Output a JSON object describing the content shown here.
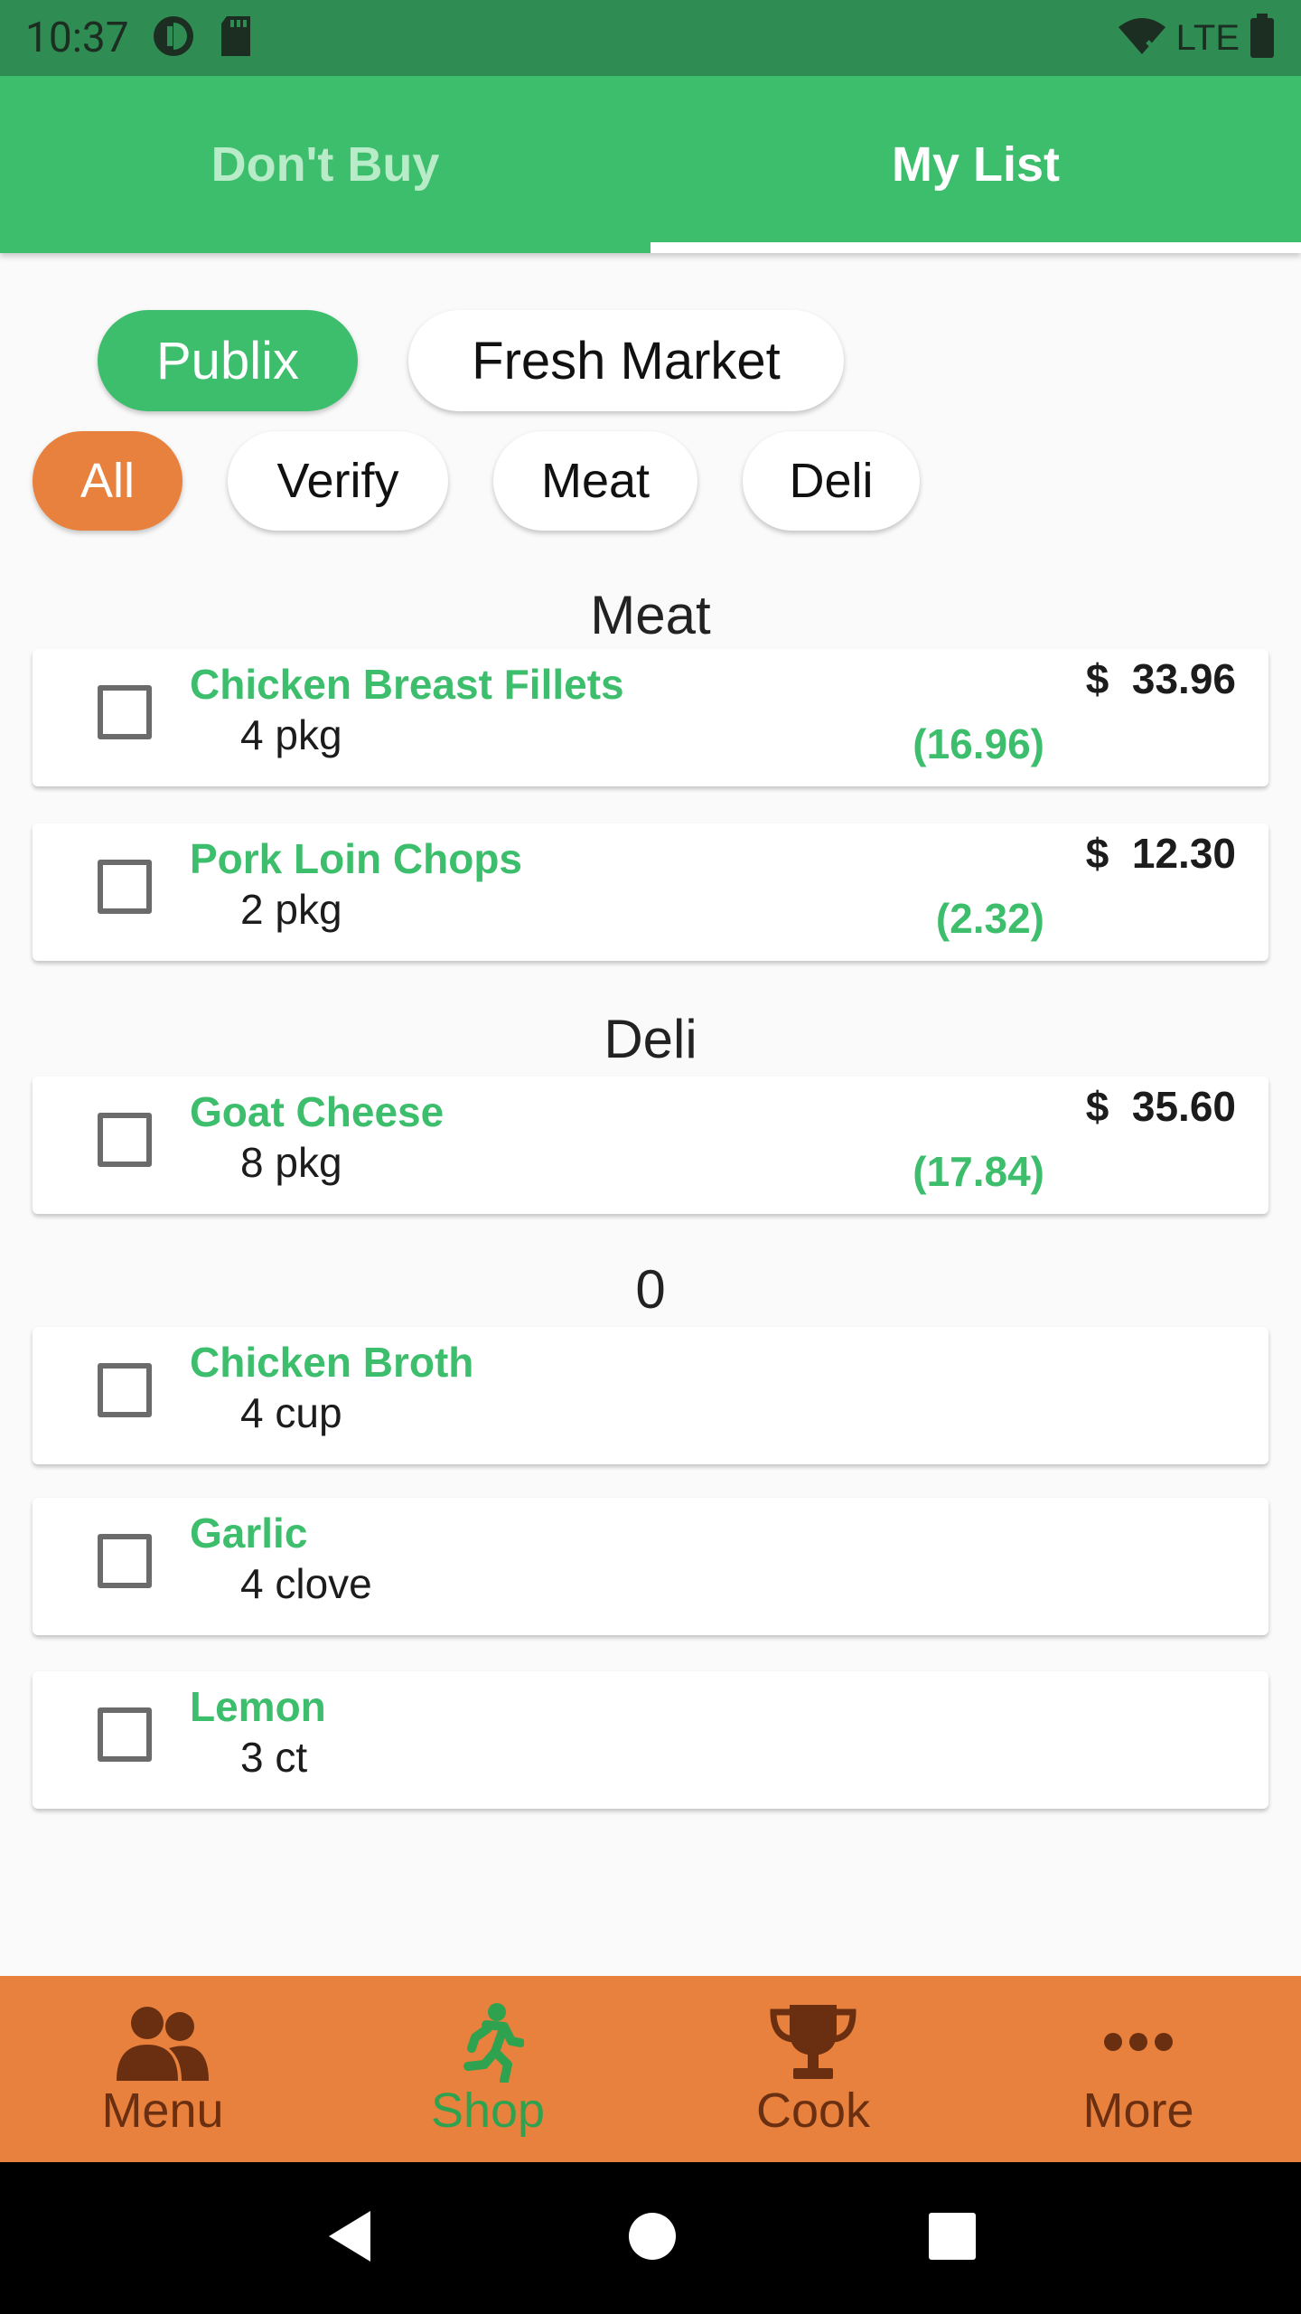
{
  "status_bar": {
    "time": "10:37",
    "network": "LTE"
  },
  "top_tabs": [
    {
      "label": "Don't Buy"
    },
    {
      "label": "My List"
    }
  ],
  "stores": [
    {
      "label": "Publix"
    },
    {
      "label": "Fresh Market"
    }
  ],
  "categories": [
    {
      "label": "All"
    },
    {
      "label": "Verify"
    },
    {
      "label": "Meat"
    },
    {
      "label": "Deli"
    }
  ],
  "sections": [
    {
      "title": "Meat",
      "items": [
        {
          "name": "Chicken Breast Fillets",
          "qty": "4 pkg",
          "price": "$  33.96",
          "sale": "(16.96)"
        },
        {
          "name": "Pork Loin Chops",
          "qty": "2 pkg",
          "price": "$  12.30",
          "sale": "(2.32)"
        }
      ]
    },
    {
      "title": "Deli",
      "items": [
        {
          "name": "Goat Cheese",
          "qty": "8 pkg",
          "price": "$  35.60",
          "sale": "(17.84)"
        }
      ]
    },
    {
      "title": "0",
      "items": [
        {
          "name": "Chicken Broth",
          "qty": "4 cup"
        },
        {
          "name": "Garlic",
          "qty": "4 clove"
        },
        {
          "name": "Lemon",
          "qty": "3 ct"
        }
      ]
    }
  ],
  "bottom_nav": [
    {
      "label": "Menu",
      "icon": "people-icon"
    },
    {
      "label": "Shop",
      "icon": "running-icon"
    },
    {
      "label": "Cook",
      "icon": "trophy-icon"
    },
    {
      "label": "More",
      "icon": "more-dots-icon"
    }
  ],
  "colors": {
    "primary_green": "#3dbe6c",
    "accent_orange": "#e8813d",
    "status_bar": "#2f8c52",
    "nav_label": "#6a2f10",
    "nav_active": "#2fa24f"
  }
}
